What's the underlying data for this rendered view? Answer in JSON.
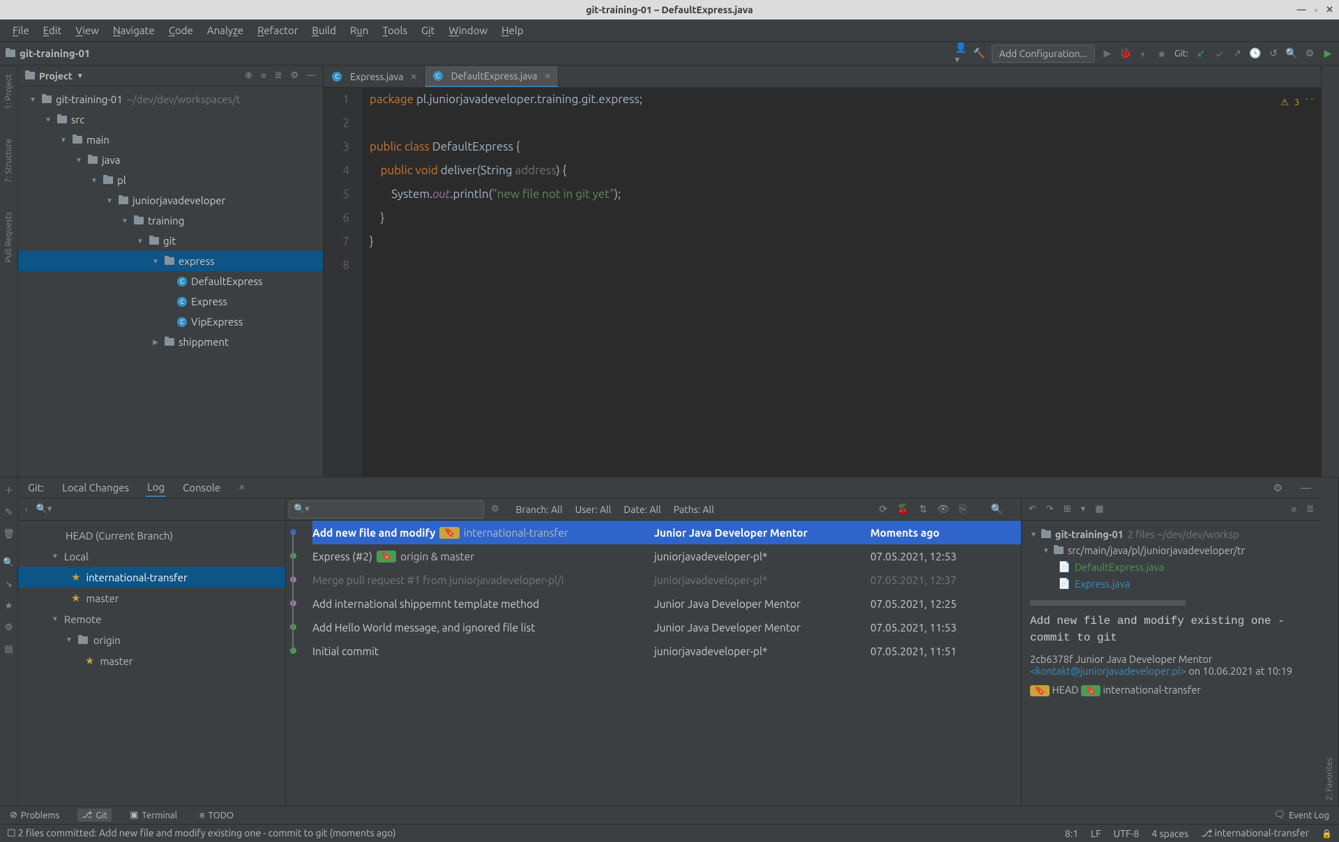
{
  "window": {
    "title": "git-training-01 – DefaultExpress.java"
  },
  "menu": [
    "File",
    "Edit",
    "View",
    "Navigate",
    "Code",
    "Analyze",
    "Refactor",
    "Build",
    "Run",
    "Tools",
    "Git",
    "Window",
    "Help"
  ],
  "breadcrumb": {
    "project": "git-training-01"
  },
  "toolbar": {
    "config": "Add Configuration...",
    "git_label": "Git:"
  },
  "project_panel": {
    "title": "Project",
    "root": "git-training-01",
    "root_path": "~/dev/dev/workspaces/t",
    "tree": [
      {
        "depth": 0,
        "kind": "folder",
        "label": "git-training-01",
        "path": "~/dev/dev/workspaces/t",
        "open": true
      },
      {
        "depth": 1,
        "kind": "folder",
        "label": "src",
        "open": true
      },
      {
        "depth": 2,
        "kind": "folder",
        "label": "main",
        "open": true
      },
      {
        "depth": 3,
        "kind": "folder",
        "label": "java",
        "open": true
      },
      {
        "depth": 4,
        "kind": "folder",
        "label": "pl",
        "open": true
      },
      {
        "depth": 5,
        "kind": "folder",
        "label": "juniorjavadeveloper",
        "open": true
      },
      {
        "depth": 6,
        "kind": "folder",
        "label": "training",
        "open": true
      },
      {
        "depth": 7,
        "kind": "folder",
        "label": "git",
        "open": true
      },
      {
        "depth": 8,
        "kind": "folder",
        "label": "express",
        "open": true,
        "sel": true
      },
      {
        "depth": 9,
        "kind": "class",
        "label": "DefaultExpress"
      },
      {
        "depth": 9,
        "kind": "class",
        "label": "Express"
      },
      {
        "depth": 9,
        "kind": "class",
        "label": "VipExpress"
      },
      {
        "depth": 8,
        "kind": "folder",
        "label": "shippment",
        "open": false,
        "closed": true
      }
    ]
  },
  "editor": {
    "tabs": [
      {
        "label": "Express.java",
        "active": false
      },
      {
        "label": "DefaultExpress.java",
        "active": true
      }
    ],
    "warnings": "3",
    "lines": {
      "l1_pkg": "package",
      "l1_rest": " pl.juniorjavadeveloper.training.git.express;",
      "l3_a": "public class",
      "l3_b": " DefaultExpress {",
      "l4_a": "public void",
      "l4_b": " deliver(String ",
      "l4_c": "address",
      "l4_d": ") {",
      "l5_a": "System.",
      "l5_b": "out",
      "l5_c": ".println(",
      "l5_d": "\"new file not in git yet\"",
      "l5_e": ");",
      "l6": "}",
      "l7": "}"
    }
  },
  "git": {
    "label": "Git:",
    "tabs": [
      "Local Changes",
      "Log",
      "Console"
    ],
    "filters": {
      "branch": "Branch: All",
      "user": "User: All",
      "date": "Date: All",
      "paths": "Paths: All"
    },
    "branches": {
      "head": "HEAD (Current Branch)",
      "local_label": "Local",
      "local": [
        "international-transfer",
        "master"
      ],
      "remote_label": "Remote",
      "remote_origin": "origin",
      "remote": [
        "master"
      ]
    },
    "commits": [
      {
        "msg": "Add new file and modify",
        "tag": "international-transfer",
        "tagcolor": "yellow",
        "author": "Junior Java Developer Mentor",
        "date": "Moments ago",
        "sel": true,
        "dot": "#2f65ca"
      },
      {
        "msg": "Express (#2)",
        "tag": "origin & master",
        "tagcolor": "green-t",
        "author": "juniorjavadeveloper-pl*",
        "date": "07.05.2021, 12:53",
        "dot": "#499c54"
      },
      {
        "msg": "Merge pull request #1 from juniorjavadeveloper-pl/i",
        "author": "juniorjavadeveloper-pl*",
        "date": "07.05.2021, 12:37",
        "faded": true,
        "dot": "#9876aa"
      },
      {
        "msg": "Add international shippemnt template method",
        "author": "Junior Java Developer Mentor",
        "date": "07.05.2021, 12:25",
        "dot": "#9876aa"
      },
      {
        "msg": "Add Hello World message, and ignored file list",
        "author": "Junior Java Developer Mentor",
        "date": "07.05.2021, 11:53",
        "dot": "#499c54"
      },
      {
        "msg": "Initial commit",
        "author": "juniorjavadeveloper-pl*",
        "date": "07.05.2021, 11:51",
        "dot": "#499c54"
      }
    ],
    "detail": {
      "root": "git-training-01",
      "root_meta": "2 files  ~/dev/dev/worksp",
      "path": "src/main/java/pl/juniorjavadeveloper/tr",
      "files": [
        "DefaultExpress.java",
        "Express.java"
      ],
      "message": "Add new file and modify existing one - commit to git",
      "hash": "2cb6378f",
      "author": "Junior Java Developer Mentor",
      "email": "<kontakt@juniorjavadeveloper.pl>",
      "on": "on 10.06.2021 at 10:19",
      "tags": [
        "HEAD",
        "international-transfer"
      ]
    }
  },
  "bottom": {
    "problems": "Problems",
    "git": "Git",
    "terminal": "Terminal",
    "todo": "TODO",
    "event": "Event Log"
  },
  "status": {
    "left": "2 files committed: Add new file and modify existing one - commit to git (moments ago)",
    "pos": "8:1",
    "lf": "LF",
    "enc": "UTF-8",
    "indent": "4 spaces",
    "branch": "international-transfer"
  },
  "side": {
    "project": "Project",
    "structure": "Structure",
    "pull": "Pull Requests",
    "fav": "Favorites"
  }
}
